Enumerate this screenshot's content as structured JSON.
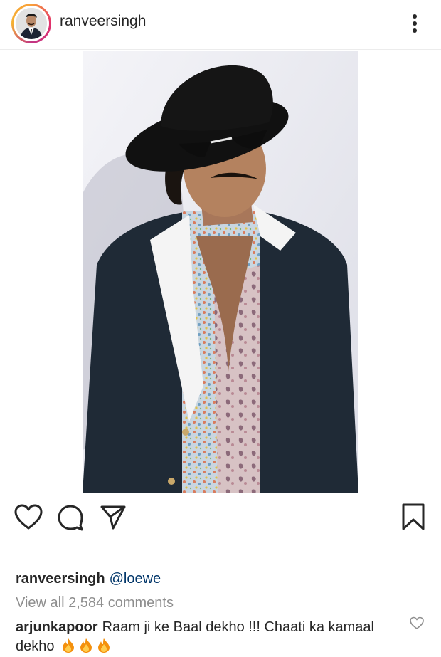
{
  "header": {
    "username": "ranveersingh",
    "avatar_icon": "profile-avatar",
    "more_icon": "vertical-ellipsis"
  },
  "post": {
    "image_description_icon": "photo-person-hat-sunglasses-suit"
  },
  "actions": {
    "like_icon": "heart-outline",
    "comment_icon": "comment-bubble",
    "share_icon": "paper-plane",
    "save_icon": "bookmark-outline"
  },
  "caption": {
    "username": "ranveersingh",
    "mention": "@loewe"
  },
  "comments": {
    "view_all": "View all 2,584 comments",
    "items": [
      {
        "username": "arjunkapoor",
        "text": "Raam ji ke Baal dekho !!! Chaati ka kamaal dekho",
        "emoji_icon": "fire-emoji",
        "emoji_count": 3
      }
    ]
  },
  "colors": {
    "text": "#262626",
    "muted": "#8e8e8e",
    "mention": "#003569",
    "story_ring_start": "#f9a03a",
    "story_ring_end": "#c13584"
  }
}
